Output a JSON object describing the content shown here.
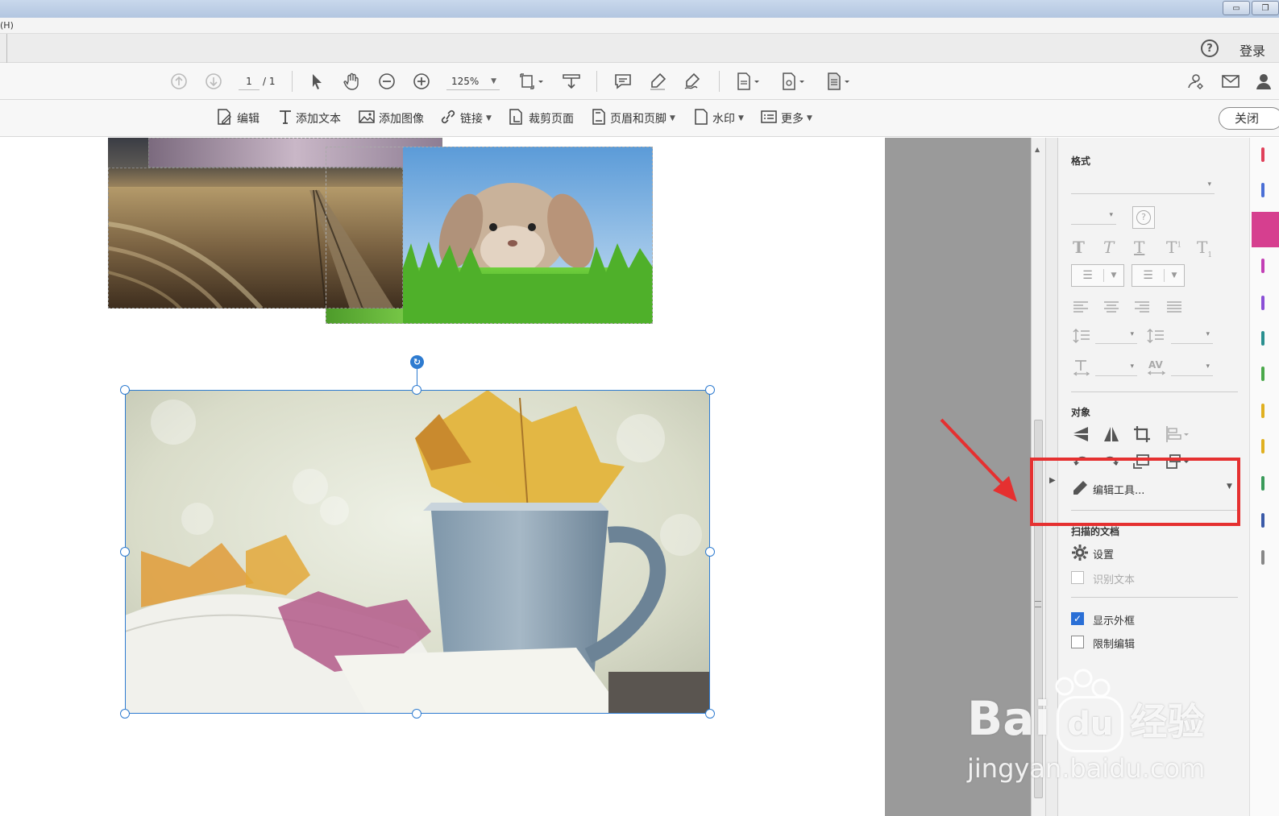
{
  "window": {
    "min": "▭",
    "restore": "❐"
  },
  "menubar": {
    "partial": "(H)"
  },
  "topstrip": {
    "help": "?",
    "login": "登录"
  },
  "toolbar": {
    "page_current": "1",
    "page_total": "/ 1",
    "zoom": "125%"
  },
  "edit_toolbar": {
    "edit": "编辑",
    "add_text": "添加文本",
    "add_image": "添加图像",
    "link": "链接",
    "crop": "裁剪页面",
    "header_footer": "页眉和页脚",
    "watermark": "水印",
    "more": "更多",
    "close": "关闭"
  },
  "panel": {
    "format_title": "格式",
    "object_title": "对象",
    "edit_tool": "编辑工具...",
    "scanned_title": "扫描的文档",
    "settings": "设置",
    "recognize_text": "识别文本",
    "show_frame": "显示外框",
    "restrict_edit": "限制编辑",
    "show_frame_checked": true,
    "restrict_edit_checked": false
  },
  "watermark": {
    "brand": "Bai",
    "brand2": "du",
    "cn": "经验",
    "url": "jingyan.baidu.com"
  },
  "colors": {
    "accent": "#2a6fd6",
    "selection": "#2e7bd0",
    "highlight_red": "#e53030"
  }
}
